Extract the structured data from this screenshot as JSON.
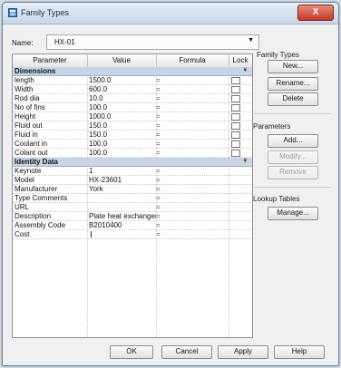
{
  "window": {
    "title": "Family Types",
    "close_glyph": "X"
  },
  "name_field": {
    "label": "Name:",
    "value": "HX-01"
  },
  "grid": {
    "columns": {
      "parameter": "Parameter",
      "value": "Value",
      "formula": "Formula",
      "lock": "Lock"
    },
    "groups": [
      {
        "label": "Dimensions",
        "collapse_glyph": "¥",
        "rows": [
          {
            "parameter": "length",
            "value": "1500.0",
            "formula": "="
          },
          {
            "parameter": "Width",
            "value": "600.0",
            "formula": "="
          },
          {
            "parameter": "Rod dia",
            "value": "10.0",
            "formula": "="
          },
          {
            "parameter": "No of fins",
            "value": "100.0",
            "formula": "="
          },
          {
            "parameter": "Height",
            "value": "1000.0",
            "formula": "="
          },
          {
            "parameter": "Fluid out",
            "value": "150.0",
            "formula": "="
          },
          {
            "parameter": "Fluid in",
            "value": "150.0",
            "formula": "="
          },
          {
            "parameter": "Coolant in",
            "value": "100.0",
            "formula": "="
          },
          {
            "parameter": "Colant out",
            "value": "100.0",
            "formula": "="
          }
        ]
      },
      {
        "label": "Identity Data",
        "collapse_glyph": "¥",
        "rows": [
          {
            "parameter": "Keynote",
            "value": "1",
            "formula": "="
          },
          {
            "parameter": "Model",
            "value": "HX-23601",
            "formula": "="
          },
          {
            "parameter": "Manufacturer",
            "value": "York",
            "formula": "="
          },
          {
            "parameter": "Type Comments",
            "value": "",
            "formula": "="
          },
          {
            "parameter": "URL",
            "value": "",
            "formula": "="
          },
          {
            "parameter": "Description",
            "value": "Plate heat exchanger",
            "formula": "="
          },
          {
            "parameter": "Assembly Code",
            "value": "B2010400",
            "formula": "="
          },
          {
            "parameter": "Cost",
            "value": "",
            "formula": "="
          }
        ]
      }
    ]
  },
  "family_types": {
    "label": "Family Types",
    "new": "New...",
    "rename": "Rename...",
    "delete": "Delete"
  },
  "parameters": {
    "label": "Parameters",
    "add": "Add...",
    "modify": "Modify...",
    "remove": "Remove"
  },
  "lookup_tables": {
    "label": "Lookup Tables",
    "manage": "Manage..."
  },
  "footer": {
    "ok": "OK",
    "cancel": "Cancel",
    "apply": "Apply",
    "help": "Help"
  }
}
